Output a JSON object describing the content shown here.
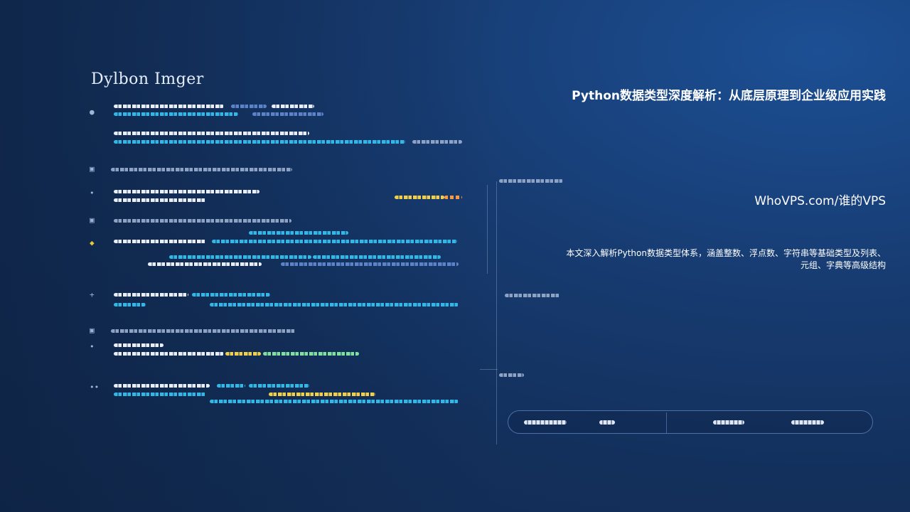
{
  "article": {
    "headline": "Python数据类型深度解析：从底层原理到企业级应用实践",
    "site": "WhoVPS.com/谁的VPS",
    "summary_line1": "本文深入解析Python数据类型体系，涵盖整数、浮点数、字符串等基础类型及列表、",
    "summary_line2": "元组、字典等高级结构"
  },
  "colors": {
    "background": "#13305c",
    "accent_cyan": "#33b7e6",
    "accent_yellow": "#f0d04a",
    "text": "#ffffff"
  }
}
